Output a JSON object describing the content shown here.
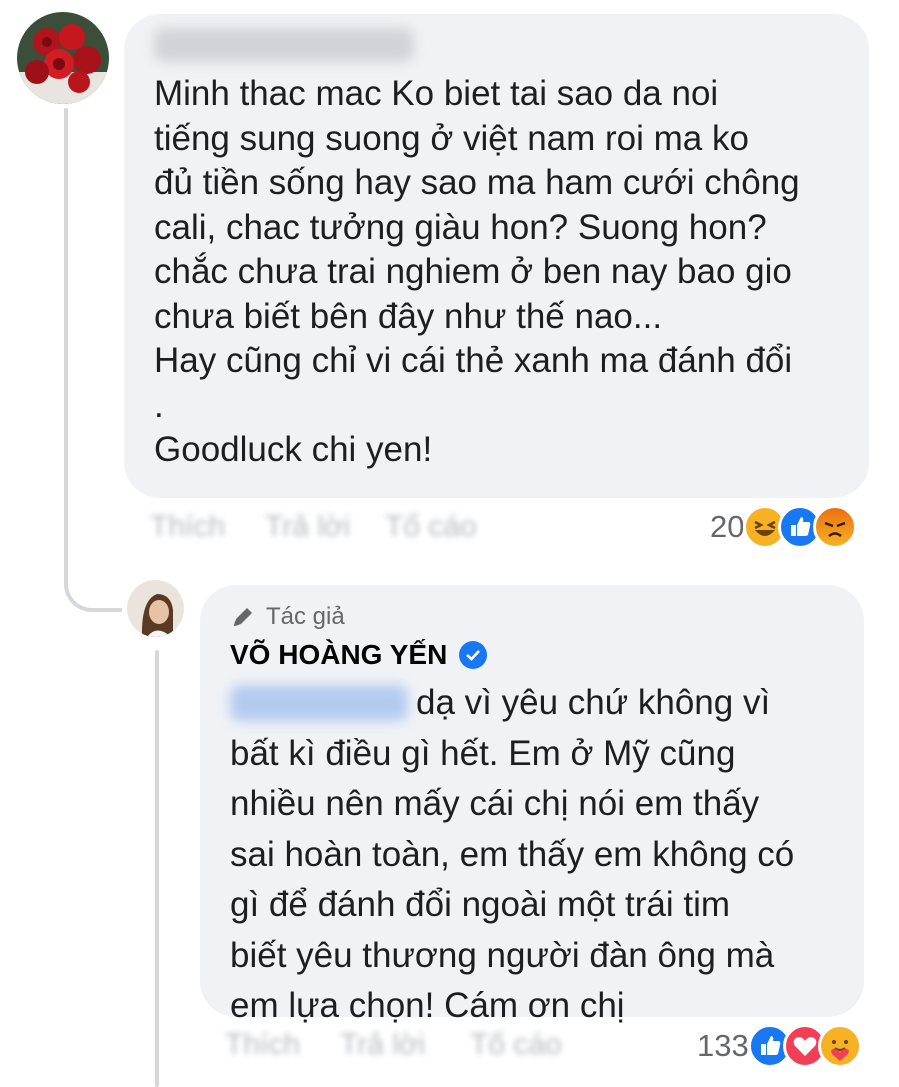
{
  "comment1": {
    "author_name": "",
    "text_lines": [
      "Minh thac mac Ko biet tai sao da noi",
      "tiếng sung suong ở việt nam roi ma ko",
      "đủ tiền sống hay sao ma ham cưới chông",
      "cali, chac tưởng giàu hon? Suong hon?",
      "chắc chưa trai nghiem ở ben nay bao gio",
      "chưa biết bên đây như thế nao...",
      "Hay cũng chỉ vi cái thẻ xanh ma đánh đổi",
      ".",
      "Goodluck chi yen!"
    ],
    "actions": [
      "Thích",
      "Trả lời",
      "Tố cáo"
    ],
    "reaction_count": "20",
    "reactions": [
      "haha-icon",
      "like-icon",
      "angry-icon"
    ]
  },
  "reply1": {
    "author_badge_icon": "pen-icon",
    "author_badge": "Tác giả",
    "author_name": "VÕ HOÀNG YẾN",
    "verified_icon": "verified-badge-icon",
    "first_line": "dạ vì yêu chứ không vì",
    "text_lines": [
      "bất kì điều gì hết. Em ở Mỹ cũng",
      "nhiều nên mấy cái chị nói em thấy",
      "sai hoàn toàn, em thấy em không có",
      "gì để đánh đổi ngoài một trái tim",
      "biết yêu thương người đàn ông mà",
      "em lựa chọn! Cám ơn chị"
    ],
    "actions": [
      "Thích",
      "Trả lời",
      "Tố cáo"
    ],
    "reaction_count": "133",
    "reactions": [
      "like-icon",
      "love-icon",
      "care-icon"
    ]
  },
  "colors": {
    "bubble_bg": "#f0f2f5",
    "like": "#1877f2",
    "love": "#f33e58",
    "emoji_yellow": "#f7b125",
    "angry_orange": "#e9710f"
  }
}
